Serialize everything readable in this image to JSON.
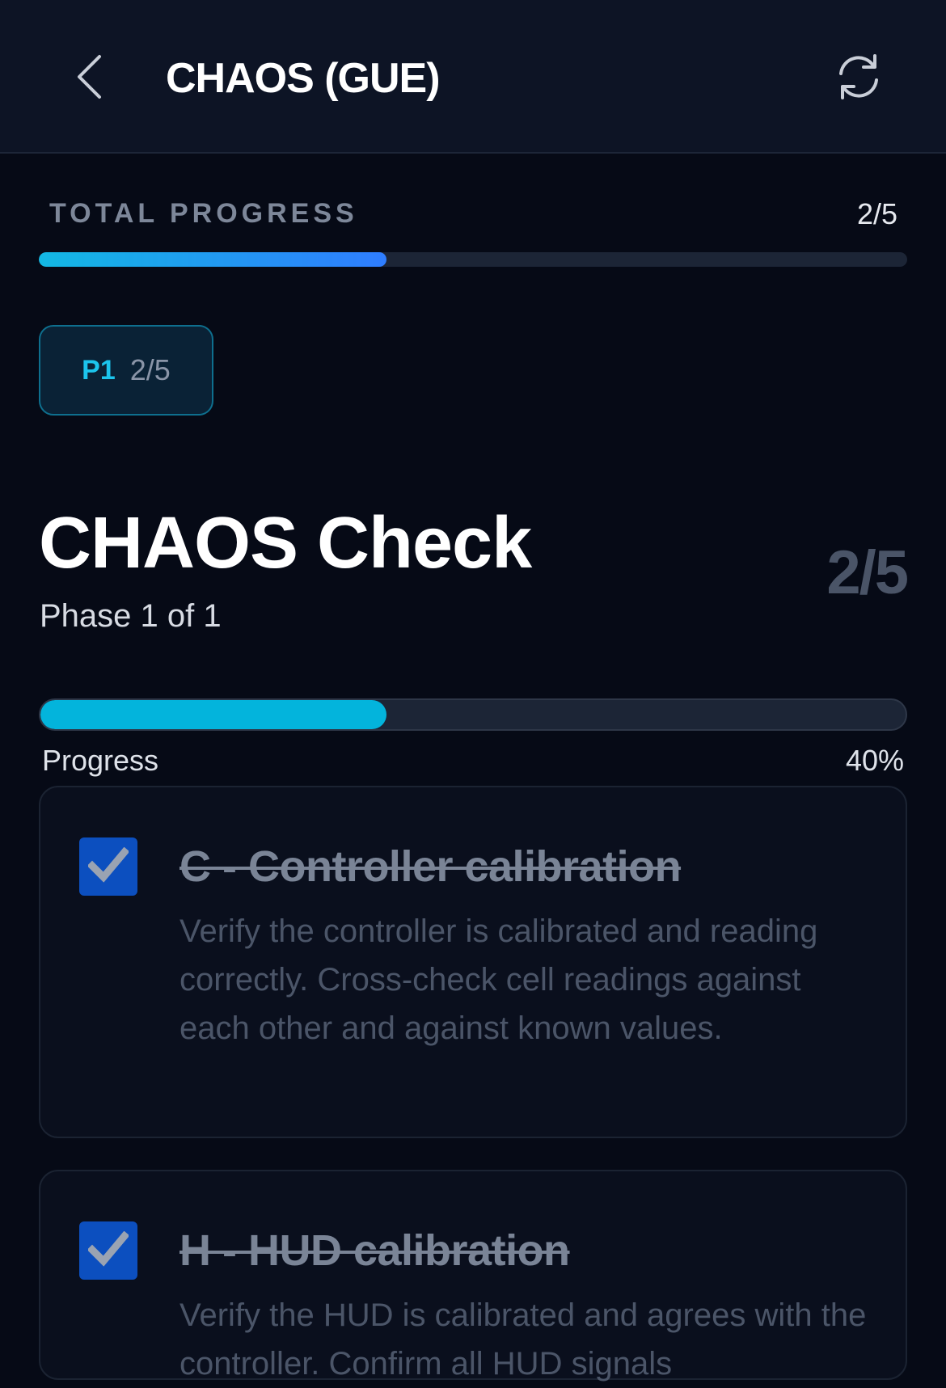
{
  "header": {
    "title": "CHAOS (GUE)",
    "back_icon": "chevron-left-icon",
    "refresh_icon": "refresh-icon"
  },
  "total_progress": {
    "label": "TOTAL PROGRESS",
    "count": "2/5",
    "fraction": 0.4
  },
  "phase_chip": {
    "code": "P1",
    "count": "2/5"
  },
  "section": {
    "title": "CHAOS Check",
    "subtitle": "Phase 1 of 1",
    "count": "2/5"
  },
  "progress": {
    "label": "Progress",
    "percent_text": "40%",
    "fraction": 0.4
  },
  "checklist": [
    {
      "checked": true,
      "title": "C - Controller calibration",
      "description": "Verify the controller is calibrated and reading correctly. Cross-check cell readings against each other and against known values."
    },
    {
      "checked": true,
      "title": "H - HUD calibration",
      "description": "Verify the HUD is calibrated and agrees with the controller. Confirm all HUD signals"
    }
  ],
  "colors": {
    "background": "#060a16",
    "accent_cyan": "#03b4dc",
    "accent_blue": "#2f7dff",
    "checkbox": "#0c4fbf"
  }
}
